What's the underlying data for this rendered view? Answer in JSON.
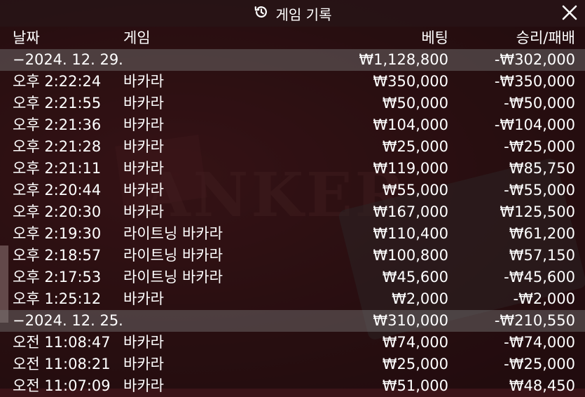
{
  "title": "게임 기록",
  "icons": {
    "history": "history-icon",
    "close": "close-icon"
  },
  "columns": {
    "date": "날짜",
    "game": "게임",
    "bet": "베팅",
    "result": "승리/패배"
  },
  "rows": [
    {
      "type": "day",
      "date": "−2024. 12. 29.",
      "game": "",
      "bet": "₩1,128,800",
      "result": "-₩302,000"
    },
    {
      "type": "game",
      "date": "오후 2:22:24",
      "game": "바카라",
      "bet": "₩350,000",
      "result": "-₩350,000"
    },
    {
      "type": "game",
      "date": "오후 2:21:55",
      "game": "바카라",
      "bet": "₩50,000",
      "result": "-₩50,000"
    },
    {
      "type": "game",
      "date": "오후 2:21:36",
      "game": "바카라",
      "bet": "₩104,000",
      "result": "-₩104,000"
    },
    {
      "type": "game",
      "date": "오후 2:21:28",
      "game": "바카라",
      "bet": "₩25,000",
      "result": "-₩25,000"
    },
    {
      "type": "game",
      "date": "오후 2:21:11",
      "game": "바카라",
      "bet": "₩119,000",
      "result": "₩85,750"
    },
    {
      "type": "game",
      "date": "오후 2:20:44",
      "game": "바카라",
      "bet": "₩55,000",
      "result": "-₩55,000"
    },
    {
      "type": "game",
      "date": "오후 2:20:30",
      "game": "바카라",
      "bet": "₩167,000",
      "result": "₩125,500"
    },
    {
      "type": "game",
      "date": "오후 2:19:30",
      "game": "라이트닝 바카라",
      "bet": "₩110,400",
      "result": "₩61,200"
    },
    {
      "type": "game",
      "date": "오후 2:18:57",
      "game": "라이트닝 바카라",
      "bet": "₩100,800",
      "result": "₩57,150"
    },
    {
      "type": "game",
      "date": "오후 2:17:53",
      "game": "라이트닝 바카라",
      "bet": "₩45,600",
      "result": "-₩45,600"
    },
    {
      "type": "game",
      "date": "오후 1:25:12",
      "game": "바카라",
      "bet": "₩2,000",
      "result": "-₩2,000"
    },
    {
      "type": "day",
      "date": "−2024. 12. 25.",
      "game": "",
      "bet": "₩310,000",
      "result": "-₩210,550"
    },
    {
      "type": "game",
      "date": "오전 11:08:47",
      "game": "바카라",
      "bet": "₩74,000",
      "result": "-₩74,000"
    },
    {
      "type": "game",
      "date": "오전 11:08:21",
      "game": "바카라",
      "bet": "₩25,000",
      "result": "-₩25,000"
    },
    {
      "type": "game",
      "date": "오전 11:07:09",
      "game": "바카라",
      "bet": "₩51,000",
      "result": "₩48,450"
    }
  ]
}
